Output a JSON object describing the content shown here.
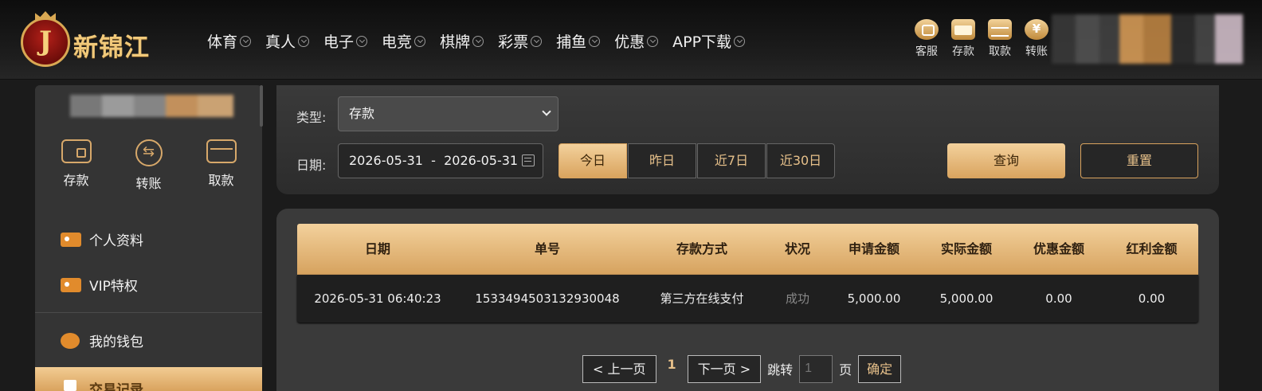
{
  "brand": {
    "logo_letter": "J",
    "name": "新锦江"
  },
  "nav": {
    "items": [
      "体育",
      "真人",
      "电子",
      "电竞",
      "棋牌",
      "彩票",
      "捕鱼",
      "优惠",
      "APP下载"
    ]
  },
  "quick_actions": [
    {
      "label": "客服",
      "icon": "customer-service-icon"
    },
    {
      "label": "存款",
      "icon": "wallet-icon"
    },
    {
      "label": "取款",
      "icon": "withdraw-icon"
    },
    {
      "label": "转账",
      "icon": "transfer-icon"
    }
  ],
  "sidebar": {
    "actions": [
      "存款",
      "转账",
      "取款"
    ],
    "menu": [
      "个人资料",
      "VIP特权",
      "我的钱包"
    ],
    "active_item": "交易记录"
  },
  "filter": {
    "type_label": "类型:",
    "type_value": "存款",
    "date_label": "日期:",
    "date_range": "2026-05-31  -  2026-05-31",
    "ranges": [
      "今日",
      "昨日",
      "近7日",
      "近30日"
    ],
    "active_range": "今日",
    "query_label": "查询",
    "reset_label": "重置"
  },
  "table": {
    "headers": [
      "日期",
      "单号",
      "存款方式",
      "状况",
      "申请金额",
      "实际金额",
      "优惠金额",
      "红利金额"
    ],
    "rows": [
      [
        "2026-05-31 06:40:23",
        "1533494503132930048",
        "第三方在线支付",
        "成功",
        "5,000.00",
        "5,000.00",
        "0.00",
        "0.00"
      ]
    ]
  },
  "pager": {
    "prev_label": "< 上一页",
    "current_page": "1",
    "next_label": "下一页 >",
    "jump_label": "跳转",
    "page_input_placeholder": "1",
    "page_unit": "页",
    "confirm_label": "确定"
  },
  "colors": {
    "accent": "#d9a35e",
    "accent_light": "#f3d19c",
    "success_status": "#888888"
  }
}
